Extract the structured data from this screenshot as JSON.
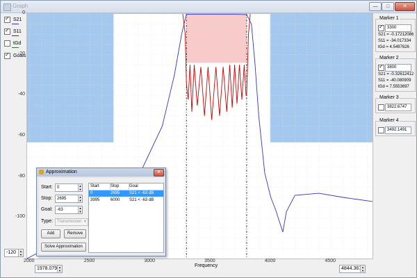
{
  "window": {
    "title": "Graph",
    "min_label": "—",
    "max_label": "□",
    "close_label": "✕"
  },
  "legend": [
    {
      "label": "S21",
      "color": "#3333cc",
      "checked": true
    },
    {
      "label": "S11",
      "color": "#cc0000",
      "checked": true
    },
    {
      "label": "tGd",
      "color": "#2a7a2a",
      "checked": false
    },
    {
      "label": "Goals",
      "color": "#6fa8dc",
      "checked": true
    }
  ],
  "y_ticks": [
    "0",
    "-20",
    "-40",
    "-60",
    "-80",
    "-100"
  ],
  "x_ticks": [
    "2000",
    "2500",
    "3000",
    "3500",
    "4000",
    "4500"
  ],
  "x_axis_title": "Frequency",
  "ymin_input": "-120",
  "xmin_input": "1978.0791",
  "xmax_input": "4844.367",
  "markers": [
    {
      "title": "Marker 1",
      "checked": true,
      "value": "3300",
      "lines": [
        "S21 = -0.17212086",
        "S11 = -34.017334",
        "tGd = 4.5497626"
      ]
    },
    {
      "title": "Marker 2",
      "checked": true,
      "value": "3800",
      "lines": [
        "S21 = -0.32612412",
        "S11 = -40.080909",
        "tGd = 7.5553697"
      ]
    },
    {
      "title": "Marker 3",
      "checked": false,
      "value": "3822.6747",
      "lines": []
    },
    {
      "title": "Marker 4",
      "checked": false,
      "value": "3492.1491",
      "lines": []
    }
  ],
  "approximation": {
    "title": "Approximation",
    "close_label": "✕",
    "start_label": "Start:",
    "start_value": "0",
    "stop_label": "Stop:",
    "stop_value": "2695",
    "goal_label": "Goal:",
    "goal_value": "-63",
    "type_label": "Type:",
    "type_value": "Transmission",
    "add_label": "Add",
    "remove_label": "Remove",
    "solve_label": "Solve Approximation",
    "columns": [
      "Start",
      "Stop",
      "Goal"
    ],
    "rows": [
      [
        "0",
        "2695",
        "S21 < -63 dB"
      ],
      [
        "3995",
        "6000",
        "S21 < -63 dB"
      ]
    ]
  },
  "chart_data": {
    "type": "line",
    "x_axis_title": "Frequency",
    "xlim": [
      1978.0791,
      4844.367
    ],
    "ylim": [
      -120,
      0
    ],
    "x_ticks": [
      2000,
      2500,
      3000,
      3500,
      4000,
      4500
    ],
    "y_ticks": [
      0,
      -20,
      -40,
      -60,
      -80,
      -100
    ],
    "goal_regions": [
      {
        "x_start": 0,
        "x_stop": 2695,
        "ymax": -63
      },
      {
        "x_start": 3995,
        "x_stop": 6000,
        "ymax": -63
      },
      {
        "x_start": 3300,
        "x_stop": 3800,
        "ymin": -24,
        "type": "passband"
      }
    ],
    "marker_lines_x": [
      3300,
      3800
    ],
    "series": [
      {
        "name": "S21",
        "color": "#3333cc",
        "x": [
          1978,
          2300,
          2600,
          2900,
          3100,
          3200,
          3260,
          3300,
          3400,
          3550,
          3700,
          3800,
          3840,
          3870,
          3900,
          3950,
          4000,
          4040,
          4100,
          4130,
          4200,
          4400,
          4600,
          4844
        ],
        "y": [
          -120,
          -110,
          -98,
          -80,
          -55,
          -30,
          -10,
          -0.2,
          -0.2,
          -0.2,
          -0.2,
          -0.3,
          -5,
          -25,
          -50,
          -78,
          -90,
          -96,
          -107,
          -97,
          -89,
          -88,
          -90,
          -92
        ]
      },
      {
        "name": "S11",
        "color": "#cc0000",
        "x": [
          3270,
          3290,
          3300,
          3315,
          3330,
          3345,
          3365,
          3390,
          3420,
          3450,
          3480,
          3510,
          3545,
          3575,
          3605,
          3635,
          3660,
          3680,
          3700,
          3720,
          3740,
          3760,
          3780,
          3795,
          3800,
          3815,
          3830
        ],
        "y": [
          0,
          -10,
          -34,
          -42,
          -25,
          -48,
          -25,
          -45,
          -26,
          -50,
          -26,
          -52,
          -26,
          -50,
          -26,
          -48,
          -25,
          -46,
          -25,
          -44,
          -25,
          -42,
          -25,
          -40,
          -40,
          -10,
          0
        ]
      }
    ]
  }
}
